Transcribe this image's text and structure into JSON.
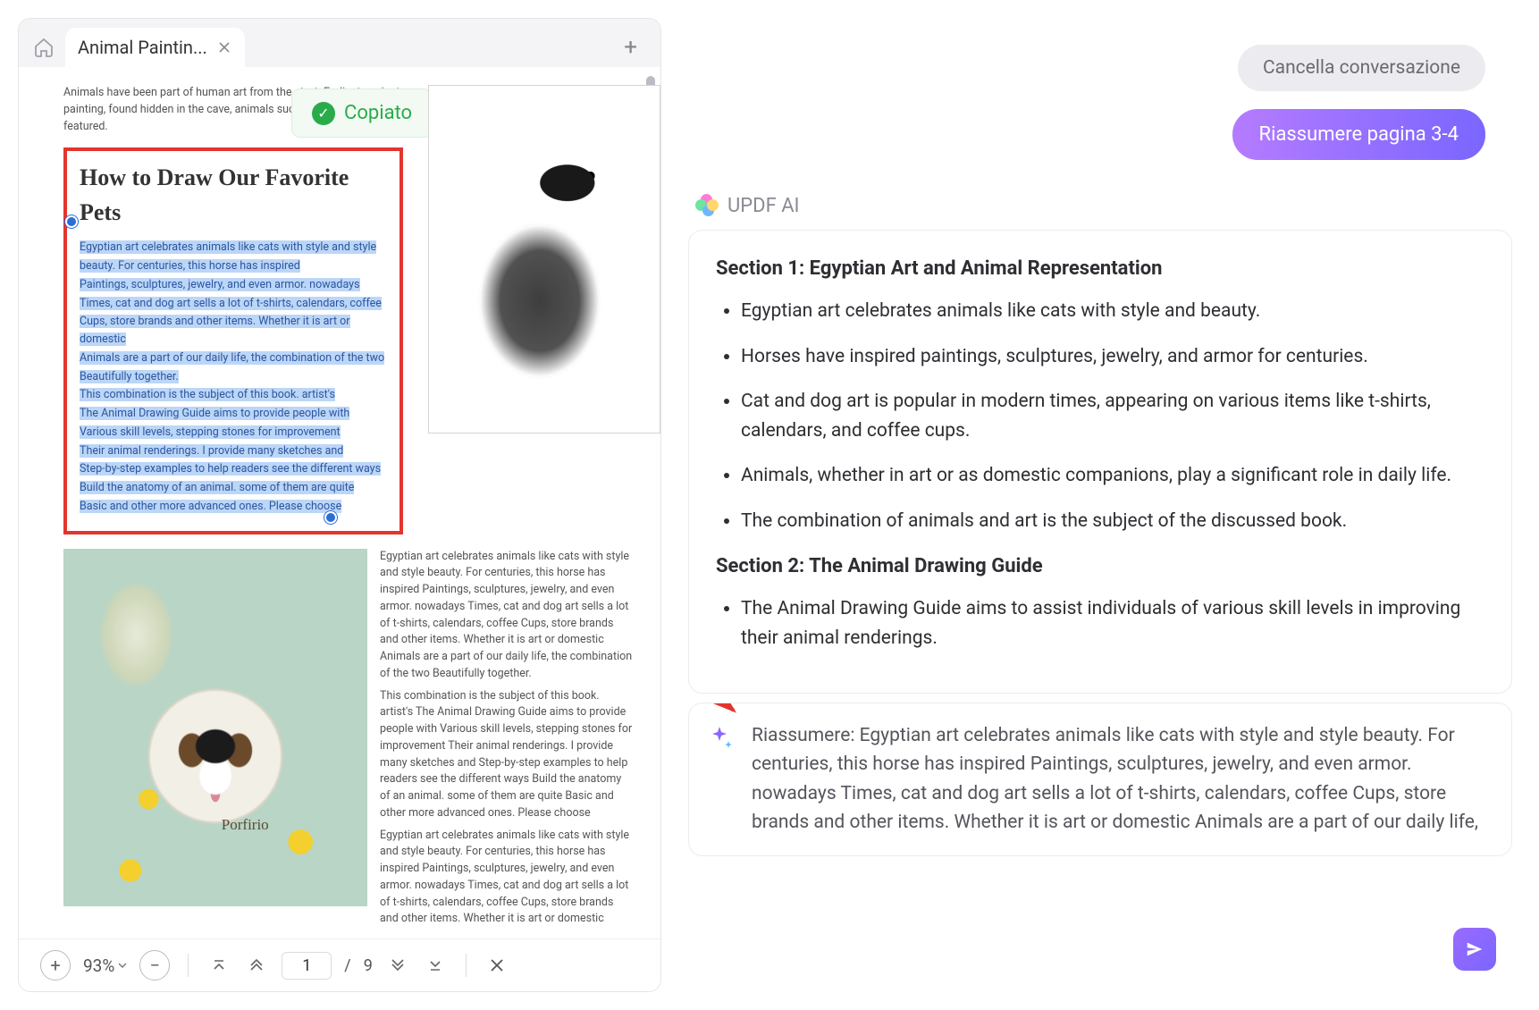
{
  "tab": {
    "title": "Animal Paintin..."
  },
  "toast": {
    "label": "Copiato"
  },
  "doc": {
    "intro": "Animals have been part of human art from the start. Earliest ancient painting, found hidden in the cave, animals such as bison (bison) are featured.",
    "heading": "How to Draw Our Favorite Pets",
    "selected_lines": [
      "Egyptian art celebrates animals like cats with style and style",
      "beauty. For centuries, this horse has inspired",
      "Paintings, sculptures, jewelry, and even armor. nowadays",
      "Times, cat and dog art sells a lot of t-shirts, calendars, coffee",
      "Cups, store brands and other items. Whether it is art or domestic",
      "Animals are a part of our daily life, the combination of the two",
      "Beautifully together.",
      "This combination is the subject of this book. artist's",
      "The Animal Drawing Guide aims to provide people with",
      "Various skill levels, stepping stones for improvement",
      "Their animal renderings. I provide many sketches and",
      "Step-by-step examples to help readers see the different ways",
      "Build the anatomy of an animal. some of them are quite",
      "Basic and other more advanced ones. Please choose"
    ],
    "signature": "Porfirio",
    "para2": "Egyptian art celebrates animals like cats with style and style beauty. For centuries, this horse has inspired Paintings, sculptures, jewelry, and even armor. nowadays Times, cat and dog art sells a lot of t-shirts, calendars, coffee Cups, store brands and other items. Whether it is art or domestic Animals are a part of our daily life, the combination of the two Beautifully together.",
    "para3": "This combination is the subject of this book. artist's The Animal Drawing Guide aims to provide people with Various skill levels, stepping stones for improvement Their animal renderings. I provide many sketches and Step-by-step examples to help readers see the different ways Build the anatomy of an animal. some of them are quite Basic and other more advanced ones. Please choose",
    "para4": "Egyptian art celebrates animals like cats with style and style beauty. For centuries, this horse has inspired Paintings, sculptures, jewelry, and even armor. nowadays Times, cat and dog art sells a lot of t-shirts, calendars, coffee Cups, store brands and other items. Whether it is art or domestic"
  },
  "toolbar": {
    "zoom": "93%",
    "page_current": "1",
    "page_sep": "/",
    "page_total": "9"
  },
  "chat": {
    "clear_label": "Cancella conversazione",
    "user_msg": "Riassumere pagina 3-4",
    "ai_label": "UPDF AI",
    "section1_title": "Section 1: Egyptian Art and Animal Representation",
    "section1_items": [
      "Egyptian art celebrates animals like cats with style and beauty.",
      "Horses have inspired paintings, sculptures, jewelry, and armor for centuries.",
      "Cat and dog art is popular in modern times, appearing on various items like t-shirts, calendars, and coffee cups.",
      "Animals, whether in art or as domestic companions, play a significant role in daily life.",
      "The combination of animals and art is the subject of the discussed book."
    ],
    "section2_title": "Section 2: The Animal Drawing Guide",
    "section2_items": [
      "The Animal Drawing Guide aims to assist individuals of various skill levels in improving their animal renderings."
    ],
    "summary_text": "Riassumere: Egyptian art celebrates animals like cats with style and style beauty. For centuries, this horse has inspired Paintings, sculptures, jewelry, and even armor. nowadays Times, cat and dog art sells a lot of t-shirts, calendars, coffee Cups, store brands and other items. Whether it is art or domestic Animals are a part of our daily life,"
  }
}
